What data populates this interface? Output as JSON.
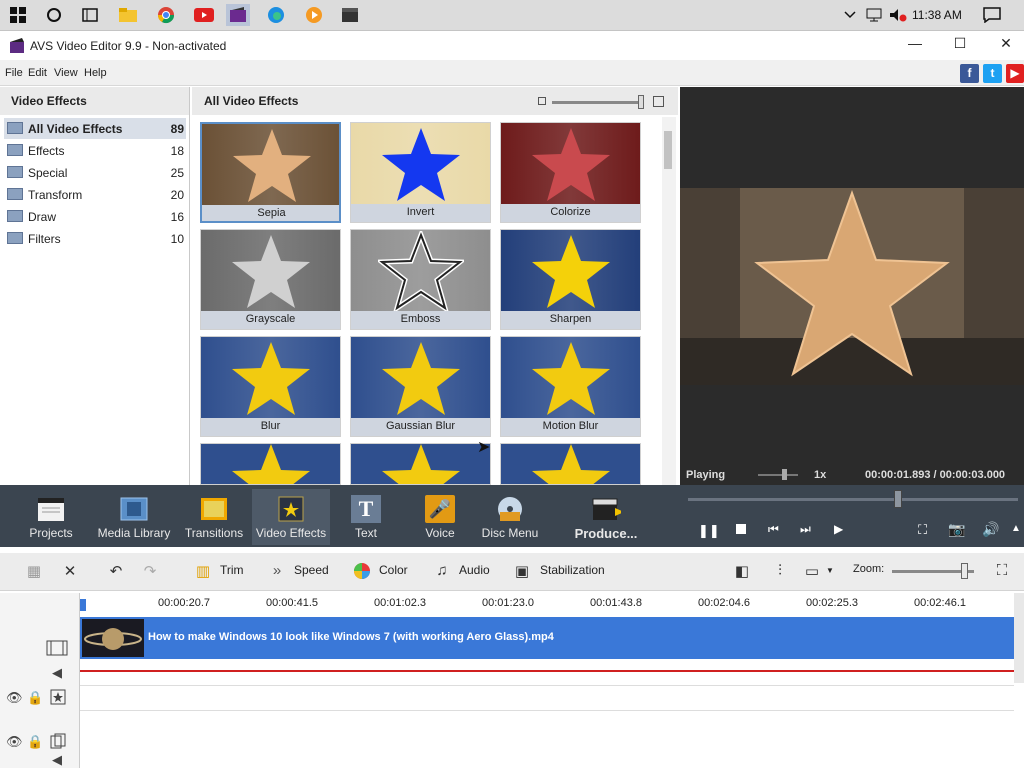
{
  "taskbar": {
    "clock": "11:38 AM"
  },
  "window": {
    "title": "AVS Video Editor 9.9 - Non-activated",
    "minimize": "—",
    "maximize": "☐",
    "close": "✕"
  },
  "menu": {
    "file": "File",
    "edit": "Edit",
    "view": "View",
    "help": "Help"
  },
  "social": {
    "facebook": "f",
    "twitter": "t",
    "youtube": "▶"
  },
  "left_panel": {
    "title": "Video Effects",
    "categories": [
      {
        "label": "All Video Effects",
        "count": "89"
      },
      {
        "label": "Effects",
        "count": "18"
      },
      {
        "label": "Special",
        "count": "25"
      },
      {
        "label": "Transform",
        "count": "20"
      },
      {
        "label": "Draw",
        "count": "16"
      },
      {
        "label": "Filters",
        "count": "10"
      }
    ]
  },
  "grid": {
    "title": "All Video Effects",
    "effects": [
      {
        "label": "Sepia",
        "bg": "#6b5136",
        "star": "#e2b07f"
      },
      {
        "label": "Invert",
        "bg": "#e9d9a8",
        "star": "#1438f0"
      },
      {
        "label": "Colorize",
        "bg": "#6e1b1b",
        "star": "#c94a4e"
      },
      {
        "label": "Grayscale",
        "bg": "#6b6b6b",
        "star": "#d0d0d0"
      },
      {
        "label": "Emboss",
        "bg": "#8e8e8e",
        "star": "#9a9a9a"
      },
      {
        "label": "Sharpen",
        "bg": "#233f7a",
        "star": "#f4d10a"
      },
      {
        "label": "Blur",
        "bg": "#2f4f8e",
        "star": "#f2cb10"
      },
      {
        "label": "Gaussian Blur",
        "bg": "#2f4f8e",
        "star": "#f2cb10"
      },
      {
        "label": "Motion Blur",
        "bg": "#2f4f8e",
        "star": "#f2cb10"
      }
    ]
  },
  "preview": {
    "status": "Playing",
    "speed": "1x",
    "time": "00:00:01.893 / 00:00:03.000"
  },
  "toolbar": {
    "projects": "Projects",
    "media_library": "Media Library",
    "transitions": "Transitions",
    "video_effects": "Video Effects",
    "text": "Text",
    "voice": "Voice",
    "disc_menu": "Disc Menu",
    "produce": "Produce..."
  },
  "editbar": {
    "trim": "Trim",
    "speed": "Speed",
    "color": "Color",
    "audio": "Audio",
    "stabilization": "Stabilization",
    "zoom": "Zoom:"
  },
  "timeline": {
    "ticks": [
      "00:00:20.7",
      "00:00:41.5",
      "00:01:02.3",
      "00:01:23.0",
      "00:01:43.8",
      "00:02:04.6",
      "00:02:25.3",
      "00:02:46.1"
    ],
    "clip_name": "How to make Windows 10 look like Windows 7 (with working Aero Glass).mp4"
  }
}
